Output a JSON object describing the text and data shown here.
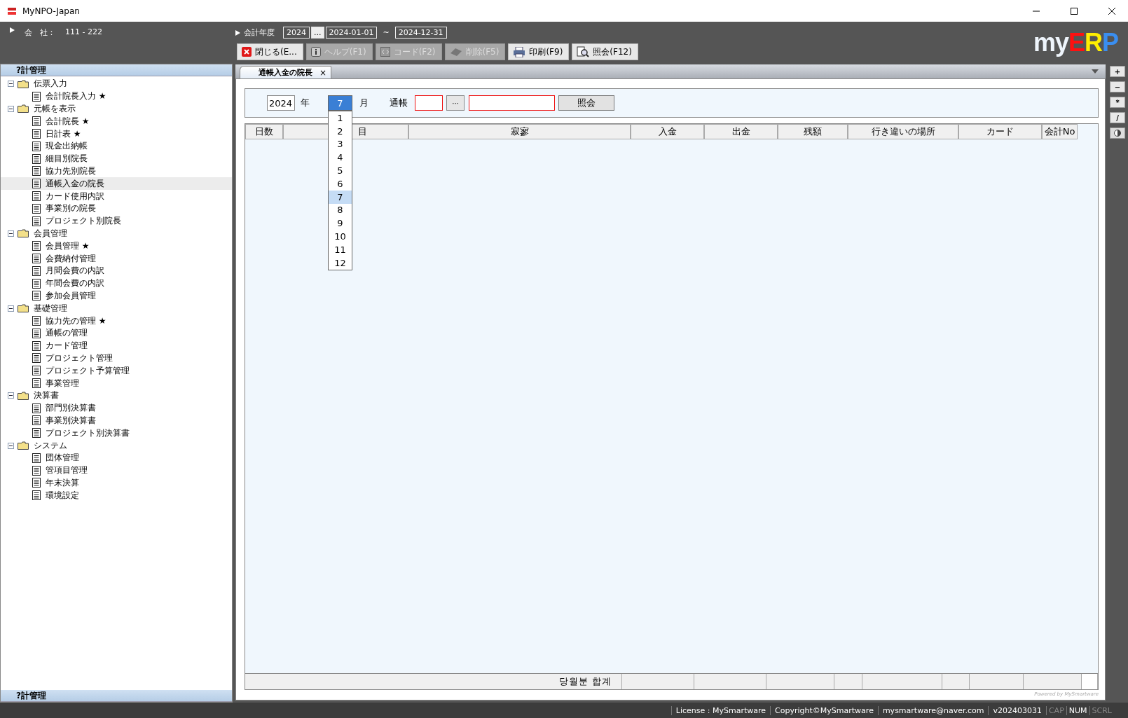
{
  "window": {
    "title": "MyNPO-Japan"
  },
  "header": {
    "company_label": "会　社：",
    "company_value": "111 - 222",
    "fiscal_label": "会計年度",
    "fiscal_year": "2024",
    "year_browse": "...",
    "start_date": "2024-01-01",
    "range_sep": "~",
    "end_date": "2024-12-31"
  },
  "logo": [
    {
      "text": "my",
      "color": "#eef4fb"
    },
    {
      "text": "E",
      "color": "#ff1010"
    },
    {
      "text": "R",
      "color": "#ffee00"
    },
    {
      "text": "P",
      "color": "#3a8ef0"
    }
  ],
  "toolbar": [
    {
      "label": "閉じる(E...",
      "kind": "close",
      "disabled": false
    },
    {
      "label": "ヘルプ(F1)",
      "kind": "info",
      "disabled": true
    },
    {
      "label": "コード(F2)",
      "kind": "code",
      "disabled": true
    },
    {
      "label": "削除(F5)",
      "kind": "eraser",
      "disabled": true
    },
    {
      "label": "印刷(F9)",
      "kind": "printer",
      "disabled": false
    },
    {
      "label": "照会(F12)",
      "kind": "search",
      "disabled": false
    }
  ],
  "sidebar": {
    "title": "?計管理",
    "footer": "?計管理",
    "tree": [
      {
        "label": "伝票入力",
        "expanded": true,
        "children": [
          {
            "label": "会計院長入力 ★",
            "selected": false
          }
        ]
      },
      {
        "label": "元帳を表示",
        "expanded": true,
        "children": [
          {
            "label": "会計院長 ★",
            "selected": false
          },
          {
            "label": "日計表 ★",
            "selected": false
          },
          {
            "label": "現金出納帳",
            "selected": false
          },
          {
            "label": "細目別院長",
            "selected": false
          },
          {
            "label": "協力先別院長",
            "selected": false
          },
          {
            "label": "通帳入金の院長",
            "selected": true
          },
          {
            "label": "カード使用内訳",
            "selected": false
          },
          {
            "label": "事業別の院長",
            "selected": false
          },
          {
            "label": "プロジェクト別院長",
            "selected": false
          }
        ]
      },
      {
        "label": "会員管理",
        "expanded": true,
        "children": [
          {
            "label": "会員管理 ★",
            "selected": false
          },
          {
            "label": "会費納付管理",
            "selected": false
          },
          {
            "label": "月間会費の内訳",
            "selected": false
          },
          {
            "label": "年間会費の内訳",
            "selected": false
          },
          {
            "label": "参加会員管理",
            "selected": false
          }
        ]
      },
      {
        "label": "基礎管理",
        "expanded": true,
        "children": [
          {
            "label": "協力先の管理 ★",
            "selected": false
          },
          {
            "label": "通帳の管理",
            "selected": false
          },
          {
            "label": "カード管理",
            "selected": false
          },
          {
            "label": "プロジェクト管理",
            "selected": false
          },
          {
            "label": "プロジェクト予算管理",
            "selected": false
          },
          {
            "label": "事業管理",
            "selected": false
          }
        ]
      },
      {
        "label": "決算書",
        "expanded": true,
        "children": [
          {
            "label": "部門別決算書",
            "selected": false
          },
          {
            "label": "事業別決算書",
            "selected": false
          },
          {
            "label": "プロジェクト別決算書",
            "selected": false
          }
        ]
      },
      {
        "label": "システム",
        "expanded": true,
        "children": [
          {
            "label": "団体管理",
            "selected": false
          },
          {
            "label": "管項目管理",
            "selected": false
          },
          {
            "label": "年末決算",
            "selected": false
          },
          {
            "label": "環境設定",
            "selected": false
          }
        ]
      }
    ]
  },
  "tabs": [
    {
      "label": "通帳入金の院長",
      "close": "×",
      "selected": true
    }
  ],
  "filter": {
    "year": "2024",
    "year_unit": "年",
    "month": "7",
    "month_unit": "月",
    "account_label": "通帳",
    "account_browse": "···",
    "query_button": "照会",
    "month_options": [
      {
        "label": "1",
        "selected": false
      },
      {
        "label": "2",
        "selected": false
      },
      {
        "label": "3",
        "selected": false
      },
      {
        "label": "4",
        "selected": false
      },
      {
        "label": "5",
        "selected": false
      },
      {
        "label": "6",
        "selected": false
      },
      {
        "label": "7",
        "selected": true
      },
      {
        "label": "8",
        "selected": false
      },
      {
        "label": "9",
        "selected": false
      },
      {
        "label": "10",
        "selected": false
      },
      {
        "label": "11",
        "selected": false
      },
      {
        "label": "12",
        "selected": false
      }
    ]
  },
  "table": {
    "columns": [
      "日数",
      "目",
      "寂寥",
      "入金",
      "出金",
      "残額",
      "行き違いの場所",
      "カード",
      "会計No"
    ],
    "footer_label": "당월분 합계"
  },
  "powered_by": "Powered by MySmartware",
  "side_buttons": [
    {
      "label": "+",
      "kind": "text"
    },
    {
      "label": "−",
      "kind": "text"
    },
    {
      "label": "*",
      "kind": "text"
    },
    {
      "label": "/",
      "kind": "text"
    },
    {
      "kind": "contrast"
    }
  ],
  "status_bar": {
    "items": [
      "License : MySmartware",
      "Copyright©MySmartware",
      "mysmartware@naver.com",
      "v202403031"
    ],
    "indicators": [
      {
        "label": "CAP",
        "on": false
      },
      {
        "label": "NUM",
        "on": true
      },
      {
        "label": "SCRL",
        "on": false
      }
    ]
  }
}
